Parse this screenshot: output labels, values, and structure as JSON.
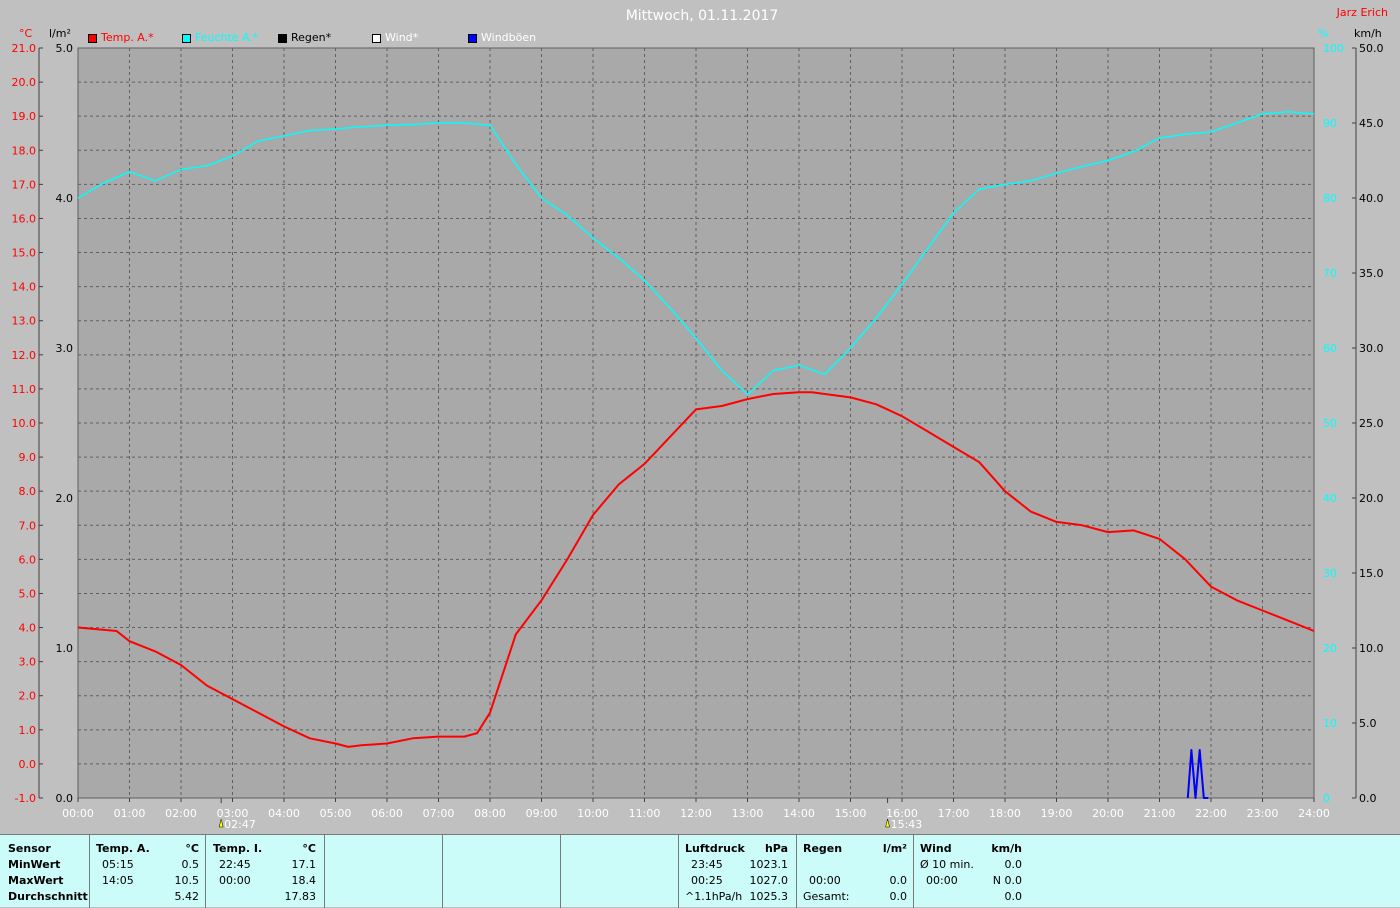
{
  "title": "Mittwoch, 01.11.2017",
  "author": "Jarz Erich",
  "legend": [
    {
      "label": "Temp. A.*",
      "color": "#ff0000",
      "text_color": "#ff0000"
    },
    {
      "label": "Feuchte A.*",
      "color": "#00ffff",
      "text_color": "#00ffff"
    },
    {
      "label": "Regen*",
      "color": "#000000",
      "text_color": "#000000"
    },
    {
      "label": "Wind*",
      "color": "#ffffff",
      "text_color": "#ffffff"
    },
    {
      "label": "Windböen",
      "color": "#0000ff",
      "text_color": "#ffffff"
    }
  ],
  "axis_units": {
    "temp": "°C",
    "rain": "l/m²",
    "hum": "%",
    "wind": "km/h"
  },
  "chart_data": {
    "type": "line",
    "title": "Mittwoch, 01.11.2017",
    "x_unit": "hours",
    "x_ticks": [
      "00:00",
      "01:00",
      "02:00",
      "03:00",
      "04:00",
      "05:00",
      "06:00",
      "07:00",
      "08:00",
      "09:00",
      "10:00",
      "11:00",
      "12:00",
      "13:00",
      "14:00",
      "15:00",
      "16:00",
      "17:00",
      "18:00",
      "19:00",
      "20:00",
      "21:00",
      "22:00",
      "23:00",
      "24:00"
    ],
    "xlim": [
      0,
      24
    ],
    "temp_axis": {
      "label": "°C",
      "ylim": [
        -1.0,
        21.0
      ],
      "ticks": [
        "-1.0",
        "0.0",
        "1.0",
        "2.0",
        "3.0",
        "4.0",
        "5.0",
        "6.0",
        "7.0",
        "8.0",
        "9.0",
        "10.0",
        "11.0",
        "12.0",
        "13.0",
        "14.0",
        "15.0",
        "16.0",
        "17.0",
        "18.0",
        "19.0",
        "20.0",
        "21.0"
      ]
    },
    "rain_axis": {
      "label": "l/m²",
      "ylim": [
        0.0,
        5.0
      ],
      "ticks": [
        "0.0",
        "1.0",
        "2.0",
        "3.0",
        "4.0",
        "5.0"
      ]
    },
    "hum_axis": {
      "label": "%",
      "ylim": [
        0,
        100
      ],
      "ticks": [
        "0",
        "10",
        "20",
        "30",
        "40",
        "50",
        "60",
        "70",
        "80",
        "90",
        "100"
      ]
    },
    "wind_axis": {
      "label": "km/h",
      "ylim": [
        0.0,
        50.0
      ],
      "ticks": [
        "0.0",
        "5.0",
        "10.0",
        "15.0",
        "20.0",
        "25.0",
        "30.0",
        "35.0",
        "40.0",
        "45.0",
        "50.0"
      ]
    },
    "markers": [
      {
        "label": "02:47",
        "x": 2.78,
        "icon": "sunrise-icon"
      },
      {
        "label": "15:43",
        "x": 15.72,
        "icon": "sunset-icon"
      }
    ],
    "grid": true,
    "series": [
      {
        "name": "Temp. A.*",
        "axis": "temp",
        "color": "#ff0000",
        "x": [
          0,
          0.75,
          1.0,
          1.5,
          2.0,
          2.5,
          3.0,
          3.5,
          4.0,
          4.5,
          5.0,
          5.25,
          5.5,
          6.0,
          6.5,
          7.0,
          7.5,
          7.75,
          8.0,
          8.5,
          9.0,
          9.5,
          10.0,
          10.5,
          11.0,
          11.5,
          12.0,
          12.5,
          13.0,
          13.5,
          14.0,
          14.25,
          14.5,
          15.0,
          15.5,
          16.0,
          16.5,
          17.0,
          17.5,
          18.0,
          18.5,
          19.0,
          19.5,
          20.0,
          20.5,
          21.0,
          21.5,
          22.0,
          22.5,
          23.0,
          23.5,
          24.0
        ],
        "y": [
          4.0,
          3.9,
          3.6,
          3.3,
          2.9,
          2.3,
          1.9,
          1.5,
          1.1,
          0.75,
          0.6,
          0.5,
          0.55,
          0.6,
          0.75,
          0.8,
          0.8,
          0.9,
          1.5,
          3.8,
          4.8,
          6.0,
          7.3,
          8.2,
          8.8,
          9.6,
          10.4,
          10.5,
          10.7,
          10.85,
          10.9,
          10.9,
          10.85,
          10.75,
          10.55,
          10.2,
          9.75,
          9.3,
          8.85,
          8.0,
          7.4,
          7.1,
          7.0,
          6.8,
          6.85,
          6.6,
          6.0,
          5.2,
          4.8,
          4.5,
          4.2,
          3.9
        ]
      },
      {
        "name": "Feuchte A.*",
        "axis": "hum",
        "color": "#00ffff",
        "x": [
          0,
          0.5,
          1.0,
          1.5,
          2.0,
          2.5,
          3.0,
          3.5,
          4.0,
          4.5,
          5.0,
          5.5,
          6.0,
          6.5,
          7.0,
          7.5,
          8.0,
          8.5,
          9.0,
          9.5,
          10.0,
          10.5,
          11.0,
          11.5,
          12.0,
          12.5,
          13.0,
          13.5,
          14.0,
          14.5,
          15.0,
          15.5,
          16.0,
          16.5,
          17.0,
          17.5,
          18.0,
          18.5,
          19.0,
          19.5,
          20.0,
          20.5,
          21.0,
          21.5,
          22.0,
          22.5,
          23.0,
          23.5,
          24.0
        ],
        "y": [
          80.0,
          82.0,
          83.5,
          82.3,
          83.8,
          84.3,
          85.6,
          87.6,
          88.3,
          89.0,
          89.2,
          89.5,
          89.7,
          89.8,
          90.0,
          90.0,
          89.7,
          84.5,
          80.0,
          77.7,
          74.7,
          72.0,
          69.0,
          65.3,
          61.3,
          57.0,
          53.8,
          57.0,
          57.7,
          56.5,
          60.0,
          64.0,
          68.5,
          73.3,
          78.0,
          81.2,
          81.8,
          82.3,
          83.3,
          84.2,
          85.0,
          86.2,
          88.0,
          88.5,
          88.8,
          90.0,
          91.2,
          91.5,
          91.2
        ]
      },
      {
        "name": "Windböen",
        "axis": "wind",
        "color": "#0000ff",
        "x": [
          21.55,
          21.62,
          21.7,
          21.78,
          21.86,
          21.95
        ],
        "y": [
          0,
          3.2,
          0,
          3.2,
          0,
          0
        ]
      }
    ]
  },
  "summary": {
    "sensor": {
      "header": "Sensor",
      "min": "MinWert",
      "max": "MaxWert",
      "avg": "Durchschnitt"
    },
    "temp_a": {
      "header": "Temp. A.",
      "unit": "°C",
      "min_time": "05:15",
      "min_val": "0.5",
      "max_time": "14:05",
      "max_val": "10.5",
      "avg": "5.42"
    },
    "temp_i": {
      "header": "Temp. I.",
      "unit": "°C",
      "min_time": "22:45",
      "min_val": "17.1",
      "max_time": "00:00",
      "max_val": "18.4",
      "avg": "17.83"
    },
    "pressure": {
      "header": "Luftdruck",
      "unit": "hPa",
      "min_time": "23:45",
      "min_val": "1023.1",
      "max_time": "00:25",
      "max_val": "1027.0",
      "trend": "^1.1hPa/h",
      "avg": "1025.3"
    },
    "rain": {
      "header": "Regen",
      "unit": "l/m²",
      "max_time": "00:00",
      "max_val": "0.0",
      "total_label": "Gesamt:",
      "total": "0.0"
    },
    "wind": {
      "header": "Wind",
      "unit": "km/h",
      "avg10_label": "Ø 10 min.",
      "avg10": "0.0",
      "max_time": "00:00",
      "max_val": "N 0.0",
      "avg": "0.0"
    }
  }
}
